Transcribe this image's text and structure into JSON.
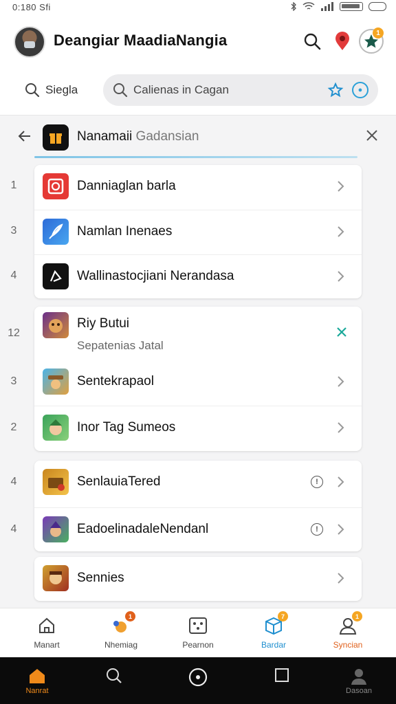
{
  "status": {
    "time": "0:180 Sfi",
    "battery_icon": "battery-icon"
  },
  "header": {
    "title": "Deangiar MaadiaNangia",
    "badge_count": "1"
  },
  "search": {
    "mini_label": "Siegla",
    "placeholder": "Calienas in Cagan"
  },
  "category": {
    "title_main": "Nanamaii",
    "title_sub": "Gadansian"
  },
  "groups": [
    {
      "rows": [
        {
          "rank": "1",
          "label": "Danniaglan barla",
          "icon": "red-square-icon",
          "action": "chevron"
        },
        {
          "rank": "3",
          "label": "Namlan Inenaes",
          "icon": "feather-icon",
          "action": "chevron"
        },
        {
          "rank": "4",
          "label": "Wallinastocjiani Nerandasa",
          "icon": "music-note-icon",
          "action": "chevron"
        }
      ]
    },
    {
      "rows": [
        {
          "rank": "12",
          "label": "Riy Butui",
          "sub": "Sepatenias Jatal",
          "icon": "game-bear-icon",
          "action": "close"
        },
        {
          "rank": "3",
          "label": "Sentekrapaol",
          "icon": "game-cowboy-icon",
          "action": "chevron"
        },
        {
          "rank": "2",
          "label": "Inor Tag Sumeos",
          "icon": "game-elf-icon",
          "action": "chevron"
        }
      ]
    },
    {
      "rows": [
        {
          "rank": "4",
          "label": "SenlauiaTered",
          "icon": "game-chest-icon",
          "action": "info-chevron"
        },
        {
          "rank": "4",
          "label": "EadoelinadaleNendanl",
          "icon": "game-wizard-icon",
          "action": "info-chevron"
        }
      ]
    },
    {
      "rows": [
        {
          "rank": "",
          "label": "Sennies",
          "icon": "game-hero-icon",
          "action": "chevron"
        }
      ]
    }
  ],
  "bottom_nav": [
    {
      "label": "Manart",
      "icon": "home-icon",
      "color": "#444444"
    },
    {
      "label": "Nhemiag",
      "icon": "games-icon",
      "color": "#444444",
      "badge": "1"
    },
    {
      "label": "Pearnon",
      "icon": "apps-icon",
      "color": "#444444"
    },
    {
      "label": "Bardar",
      "icon": "box-icon",
      "color": "#1f8fcf",
      "badge": "7"
    },
    {
      "label": "Syncian",
      "icon": "person-icon",
      "color": "#e0601b",
      "badge": "1"
    }
  ],
  "system_nav": [
    {
      "label": "Nanrat",
      "icon": "home-icon"
    },
    {
      "label": "",
      "icon": "search-icon"
    },
    {
      "label": "",
      "icon": "compass-icon"
    },
    {
      "label": "",
      "icon": "square-icon"
    },
    {
      "label": "Dasoan",
      "icon": "person-icon"
    }
  ],
  "colors": {
    "accent": "#f5a623",
    "teal": "#1aa89a",
    "orange": "#e0601b"
  }
}
